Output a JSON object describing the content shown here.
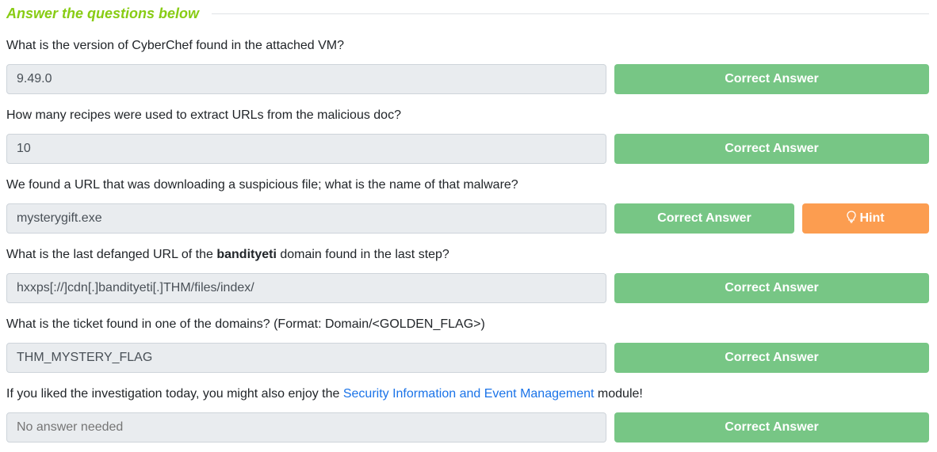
{
  "header": {
    "title": "Answer the questions below"
  },
  "questions": [
    {
      "text": "What is the version of CyberChef found in the attached VM?",
      "answer": "9.49.0",
      "button": "Correct Answer"
    },
    {
      "text": "How many recipes were used to extract URLs from the malicious doc?",
      "answer": "10",
      "button": "Correct Answer"
    },
    {
      "text": "We found a URL that was downloading a suspicious file; what is the name of that malware?",
      "answer": "mysterygift.exe",
      "button": "Correct Answer",
      "hint": "Hint"
    },
    {
      "text_before": "What is the last defanged URL of the ",
      "text_bold": "bandityeti",
      "text_after": " domain found in the last step?",
      "answer": "hxxps[://]cdn[.]bandityeti[.]THM/files/index/",
      "button": "Correct Answer"
    },
    {
      "text": "What is the ticket found in one of the domains? (Format: Domain/<GOLDEN_FLAG>)",
      "answer": "THM_MYSTERY_FLAG",
      "button": "Correct Answer"
    },
    {
      "text_before": "If you liked the investigation today, you might also enjoy the ",
      "link": "Security Information and Event Management",
      "text_after": " module!",
      "placeholder": "No answer needed",
      "button": "Correct Answer"
    }
  ],
  "colors": {
    "accent": "#88cc14",
    "correct": "#77c685",
    "hint": "#fc9d50",
    "link": "#1a73e8"
  },
  "icons": {
    "hint": "lightbulb-icon"
  }
}
